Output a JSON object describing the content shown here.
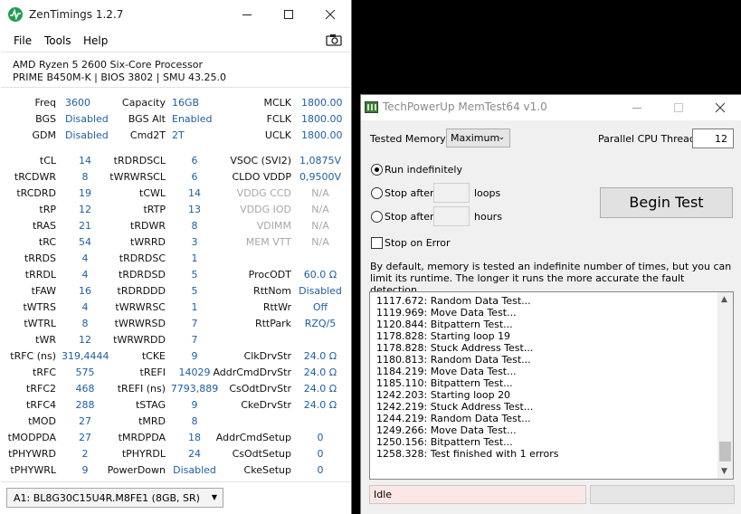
{
  "zentimings": {
    "title": "ZenTimings 1.2.7",
    "menu": [
      "File",
      "Tools",
      "Help"
    ],
    "cpu": "AMD Ryzen 5 2600 Six-Core Processor",
    "board": "PRIME B450M-K | BIOS 3802 | SMU 43.25.0",
    "rows_top": [
      [
        "Freq",
        "3600",
        "Capacity",
        "16GB",
        "MCLK",
        "1800.00"
      ],
      [
        "BGS",
        "Disabled",
        "BGS Alt",
        "Enabled",
        "FCLK",
        "1800.00"
      ],
      [
        "GDM",
        "Disabled",
        "Cmd2T",
        "2T",
        "UCLK",
        "1800.00"
      ]
    ],
    "rows": [
      [
        "tCL",
        "14",
        "tRDRDSCL",
        "6",
        "VSOC (SVI2)",
        "1,0875V"
      ],
      [
        "tRCDWR",
        "8",
        "tWRWRSCL",
        "6",
        "CLDO VDDP",
        "0,9500V"
      ],
      [
        "tRCDRD",
        "19",
        "tCWL",
        "14",
        "VDDG CCD",
        "N/A"
      ],
      [
        "tRP",
        "12",
        "tRTP",
        "13",
        "VDDG IOD",
        "N/A"
      ],
      [
        "tRAS",
        "21",
        "tRDWR",
        "8",
        "VDIMM",
        "N/A"
      ],
      [
        "tRC",
        "54",
        "tWRRD",
        "3",
        "MEM VTT",
        "N/A"
      ],
      [
        "tRRDS",
        "4",
        "tRDRDSC",
        "1",
        "",
        ""
      ],
      [
        "tRRDL",
        "4",
        "tRDRDSD",
        "5",
        "ProcODT",
        "60.0 Ω"
      ],
      [
        "tFAW",
        "16",
        "tRDRDDD",
        "5",
        "RttNom",
        "Disabled"
      ],
      [
        "tWTRS",
        "4",
        "tWRWRSC",
        "1",
        "RttWr",
        "Off"
      ],
      [
        "tWTRL",
        "8",
        "tWRWRSD",
        "7",
        "RttPark",
        "RZQ/5"
      ],
      [
        "tWR",
        "12",
        "tWRWRDD",
        "7",
        "",
        ""
      ],
      [
        "tRFC (ns)",
        "319,4444",
        "tCKE",
        "9",
        "ClkDrvStr",
        "24.0 Ω"
      ],
      [
        "tRFC",
        "575",
        "tREFI",
        "14029",
        "AddrCmdDrvStr",
        "24.0 Ω"
      ],
      [
        "tRFC2",
        "468",
        "tREFI (ns)",
        "7793,889",
        "CsOdtDrvStr",
        "24.0 Ω"
      ],
      [
        "tRFC4",
        "288",
        "tSTAG",
        "9",
        "CkeDrvStr",
        "24.0 Ω"
      ],
      [
        "tMOD",
        "27",
        "tMRD",
        "8",
        "",
        ""
      ],
      [
        "tMODPDA",
        "27",
        "tMRDPDA",
        "18",
        "AddrCmdSetup",
        "0"
      ],
      [
        "tPHYWRD",
        "2",
        "tPHYRDL",
        "24",
        "CsOdtSetup",
        "0"
      ],
      [
        "tPHYWRL",
        "9",
        "PowerDown",
        "Disabled",
        "CkeSetup",
        "0"
      ]
    ],
    "dimm": "A1: BL8G30C15U4R.M8FE1 (8GB, SR)"
  },
  "memtest": {
    "title": "TechPowerUp MemTest64 v1.0",
    "tested_memory_label": "Tested Memory:",
    "tested_memory_value": "Maximum",
    "threads_label": "Parallel CPU Threads:",
    "threads_value": "12",
    "run_indef": "Run indefinitely",
    "stop_after": "Stop after",
    "loops": "loops",
    "hours": "hours",
    "stop_on_error": "Stop on Error",
    "begin": "Begin Test",
    "description": "By default, memory is tested an indefinite number of times, but you can limit its runtime. The longer it runs the more accurate the fault detection.",
    "log": [
      "1117.672: Random Data Test...",
      "1119.969: Move Data Test...",
      "1120.844: Bitpattern Test...",
      "1178.828: Starting loop 19",
      "1178.828: Stuck Address Test...",
      "1180.813: Random Data Test...",
      "1184.219: Move Data Test...",
      "1185.110: Bitpattern Test...",
      "1242.203: Starting loop 20",
      "1242.219: Stuck Address Test...",
      "1244.219: Random Data Test...",
      "1249.266: Move Data Test...",
      "1250.156: Bitpattern Test...",
      "1258.328: Test finished with 1 errors"
    ],
    "status": "Idle"
  }
}
